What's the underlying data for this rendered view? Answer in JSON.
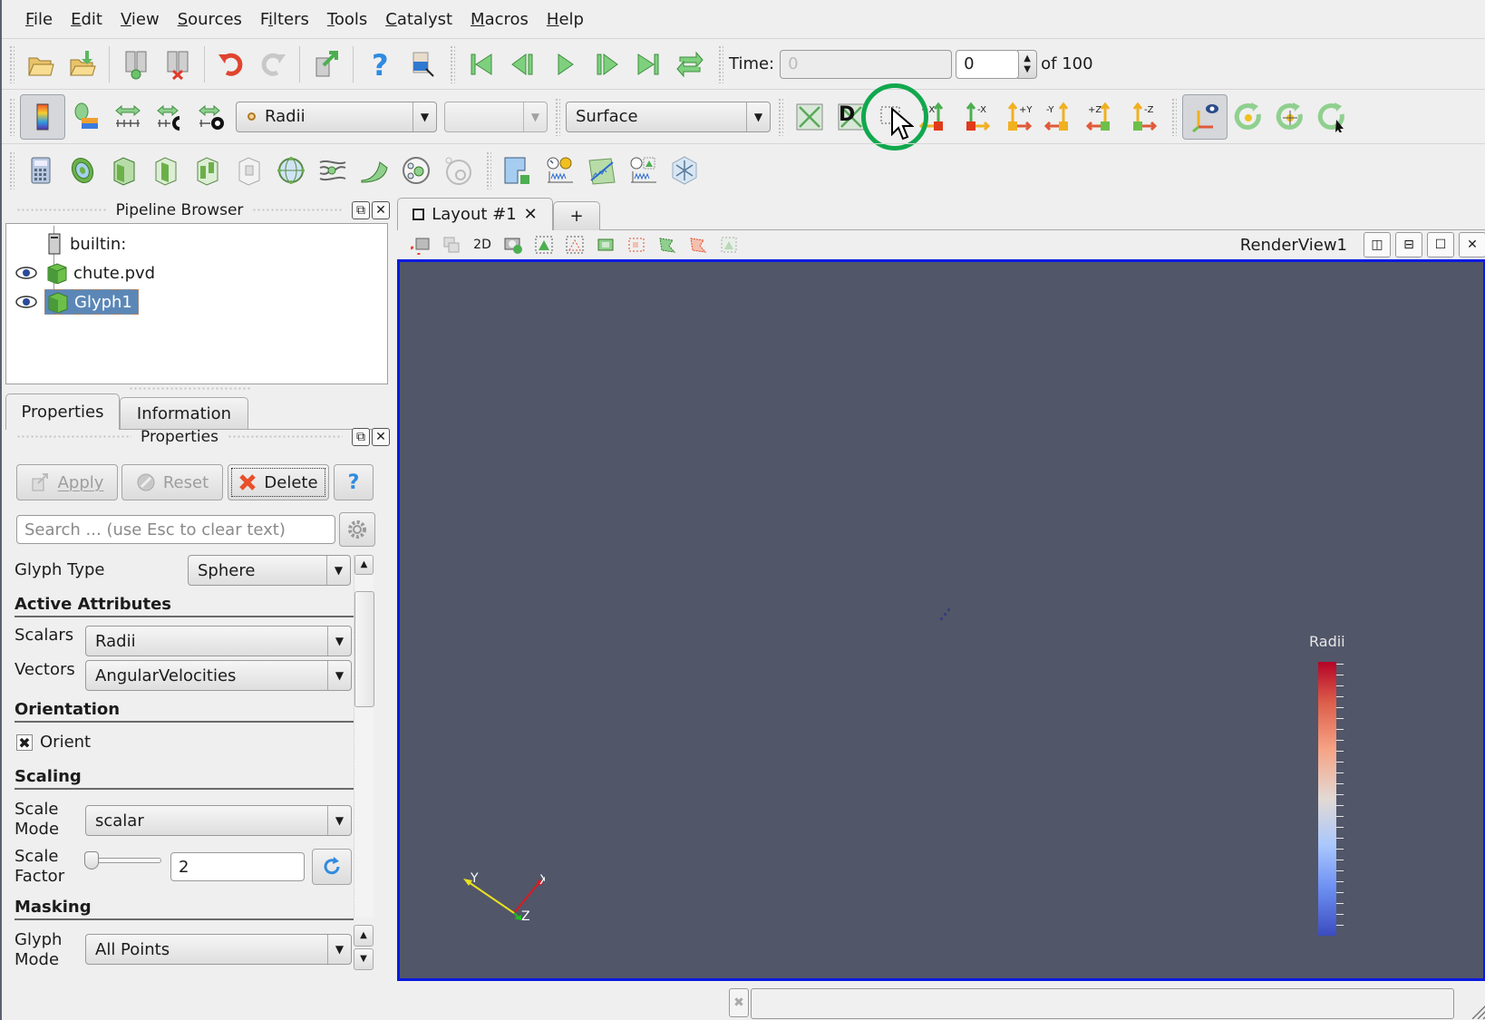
{
  "menubar": {
    "items": [
      {
        "label": "File",
        "mnemonic": "F"
      },
      {
        "label": "Edit",
        "mnemonic": "E"
      },
      {
        "label": "View",
        "mnemonic": "V"
      },
      {
        "label": "Sources",
        "mnemonic": "S"
      },
      {
        "label": "Filters",
        "mnemonic": "i"
      },
      {
        "label": "Tools",
        "mnemonic": "T"
      },
      {
        "label": "Catalyst",
        "mnemonic": "C"
      },
      {
        "label": "Macros",
        "mnemonic": "M"
      },
      {
        "label": "Help",
        "mnemonic": "H"
      }
    ]
  },
  "toolbar_main": {
    "icons": [
      "open-file-icon",
      "load-state-icon",
      "connect-icon",
      "disconnect-icon",
      "undo-icon",
      "redo-icon",
      "reset-session-icon",
      "help-icon",
      "find-data-icon"
    ],
    "vcr": [
      "first-frame-icon",
      "previous-frame-icon",
      "play-icon",
      "next-frame-icon",
      "last-frame-icon",
      "loop-icon"
    ],
    "time_label": "Time:",
    "time_value": "0",
    "timestep_value": "0",
    "timestep_total": "of 100"
  },
  "toolbar_color": {
    "color_array": "Radii",
    "component": "",
    "representation": "Surface"
  },
  "toolbar_camera": {
    "axis_labels": [
      "+X",
      "-X",
      "+Y",
      "-Y",
      "+Z",
      "-Z"
    ]
  },
  "pipeline": {
    "title": "Pipeline Browser",
    "items": [
      {
        "label": "builtin:",
        "type": "server"
      },
      {
        "label": "chute.pvd",
        "type": "source",
        "visible": true
      },
      {
        "label": "Glyph1",
        "type": "filter",
        "visible": true,
        "selected": true
      }
    ]
  },
  "tabs": {
    "properties": "Properties",
    "information": "Information"
  },
  "properties": {
    "title": "Properties",
    "apply": "Apply",
    "reset": "Reset",
    "delete": "Delete",
    "help": "?",
    "search_placeholder": "Search ... (use Esc to clear text)",
    "glyph_type_label": "Glyph Type",
    "glyph_type_value": "Sphere",
    "active_attributes": "Active Attributes",
    "scalars_label": "Scalars",
    "scalars_value": "Radii",
    "vectors_label": "Vectors",
    "vectors_value": "AngularVelocities",
    "orientation": "Orientation",
    "orient_label": "Orient",
    "orient_checked": true,
    "scaling": "Scaling",
    "scale_mode_label1": "Scale",
    "scale_mode_label2": "Mode",
    "scale_mode_value": "scalar",
    "scale_factor_label1": "Scale",
    "scale_factor_label2": "Factor",
    "scale_factor_value": "2",
    "masking": "Masking",
    "glyph_mode_label1": "Glyph",
    "glyph_mode_label2": "Mode",
    "glyph_mode_value": "All Points"
  },
  "layout": {
    "tab_label": "Layout #1",
    "add_tab": "+",
    "view_toolbar": {
      "twod_label": "2D"
    },
    "view_name": "RenderView1"
  },
  "render": {
    "background": "#515669",
    "border_color": "#0a1ae0",
    "legend_title": "Radii",
    "axes": {
      "x": "X",
      "y": "Y",
      "z": "Z"
    }
  }
}
